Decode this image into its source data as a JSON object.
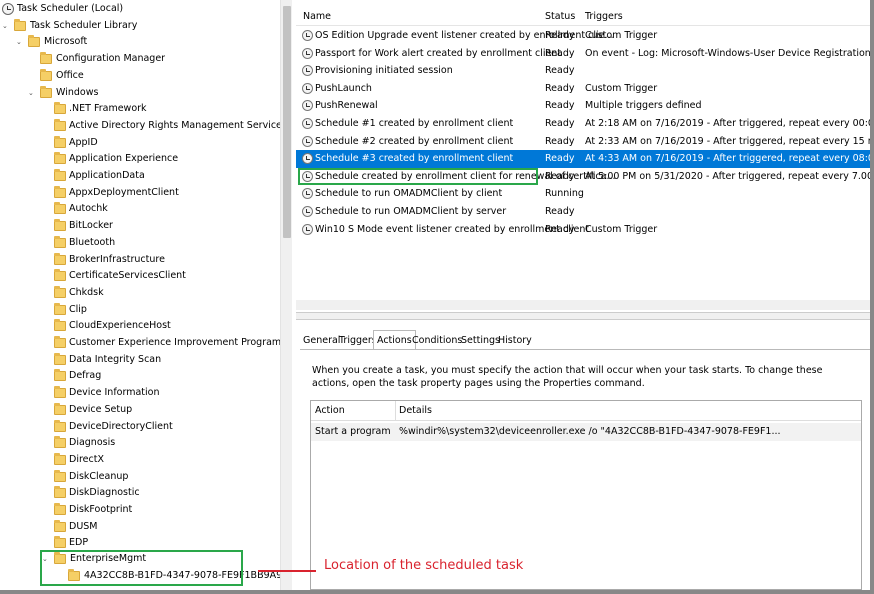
{
  "tree": {
    "root": "Task Scheduler (Local)",
    "library": "Task Scheduler Library",
    "microsoft": "Microsoft",
    "config_manager": "Configuration Manager",
    "office": "Office",
    "windows": "Windows",
    "windows_children": [
      ".NET Framework",
      "Active Directory Rights Management Services Client",
      "AppID",
      "Application Experience",
      "ApplicationData",
      "AppxDeploymentClient",
      "Autochk",
      "BitLocker",
      "Bluetooth",
      "BrokerInfrastructure",
      "CertificateServicesClient",
      "Chkdsk",
      "Clip",
      "CloudExperienceHost",
      "Customer Experience Improvement Program",
      "Data Integrity Scan",
      "Defrag",
      "Device Information",
      "Device Setup",
      "DeviceDirectoryClient",
      "Diagnosis",
      "DirectX",
      "DiskCleanup",
      "DiskDiagnostic",
      "DiskFootprint",
      "DUSM",
      "EDP"
    ],
    "enterprise_mgmt": "EnterpriseMgmt",
    "enterprise_child": "4A32CC8B-B1FD-4347-9078-FE9F1BB9A91C"
  },
  "tasks": {
    "headers": {
      "name": "Name",
      "status": "Status",
      "triggers": "Triggers"
    },
    "rows": [
      {
        "name": "OS Edition Upgrade event listener created by enrollment clie...",
        "status": "Ready",
        "triggers": "Custom Trigger"
      },
      {
        "name": "Passport for Work alert created by enrollment client",
        "status": "Ready",
        "triggers": "On event - Log: Microsoft-Windows-User Device Registration/Admin, Source: M"
      },
      {
        "name": "Provisioning initiated session",
        "status": "Ready",
        "triggers": ""
      },
      {
        "name": "PushLaunch",
        "status": "Ready",
        "triggers": "Custom Trigger"
      },
      {
        "name": "PushRenewal",
        "status": "Ready",
        "triggers": "Multiple triggers defined"
      },
      {
        "name": "Schedule #1 created by enrollment client",
        "status": "Ready",
        "triggers": "At 2:18 AM on 7/16/2019 - After triggered, repeat every 00:03:00 for a duration of"
      },
      {
        "name": "Schedule #2 created by enrollment client",
        "status": "Ready",
        "triggers": "At 2:33 AM on 7/16/2019 - After triggered, repeat every 15 minutes for a duration o"
      },
      {
        "name": "Schedule #3 created by enrollment client",
        "status": "Ready",
        "triggers": "At 4:33 AM on 7/16/2019 - After triggered, repeat every 08:00:00 indefinitely."
      },
      {
        "name": "Schedule created by enrollment client for renewal of certifica...",
        "status": "Ready",
        "triggers": "At 5:00 PM on 5/31/2020 - After triggered, repeat every 7.00:00:00 for a duration o"
      },
      {
        "name": "Schedule to run OMADMClient by client",
        "status": "Running",
        "triggers": ""
      },
      {
        "name": "Schedule to run OMADMClient by server",
        "status": "Ready",
        "triggers": ""
      },
      {
        "name": "Win10 S Mode event listener created by enrollment client",
        "status": "Ready",
        "triggers": "Custom Trigger"
      }
    ]
  },
  "tabs": [
    "General",
    "Triggers",
    "Actions",
    "Conditions",
    "Settings",
    "History"
  ],
  "actions_panel": {
    "description": "When you create a task, you must specify the action that will occur when your task starts.  To change these actions, open the task property pages using the Properties command.",
    "headers": {
      "action": "Action",
      "details": "Details"
    },
    "row": {
      "action": "Start a program",
      "details": "%windir%\\system32\\deviceenroller.exe /o \"4A32CC8B-B1FD-4347-9078-FE9F1..."
    }
  },
  "annotation": "Location of the scheduled task",
  "colors": {
    "selection": "#0078d7",
    "highlight_box": "#2aa74a",
    "annotation": "#d9232e"
  }
}
